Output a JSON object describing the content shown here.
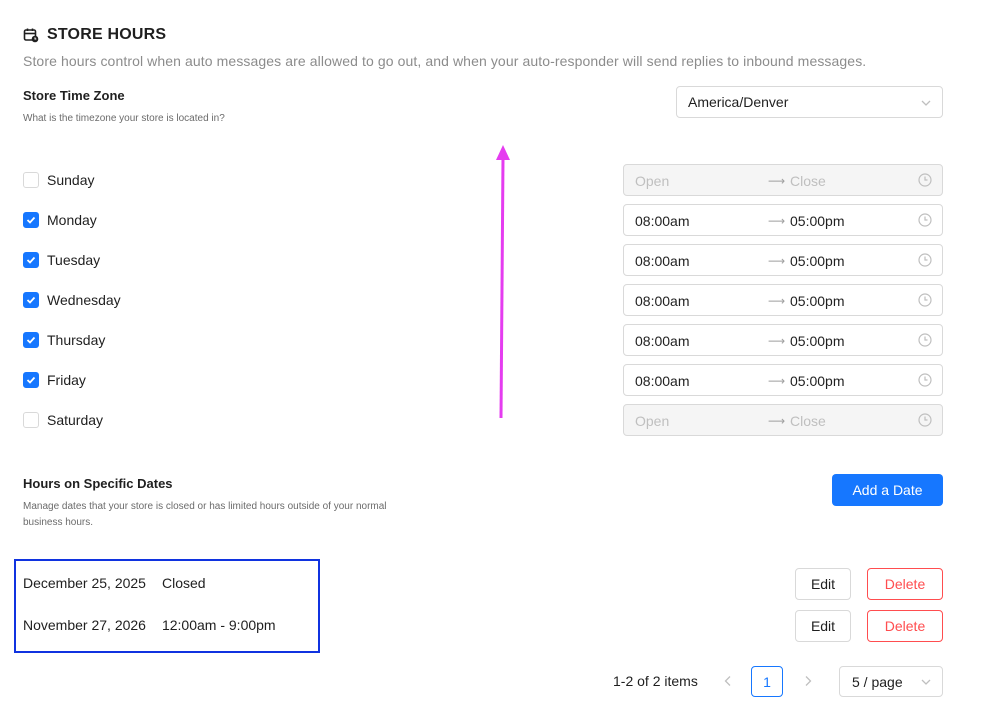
{
  "header": {
    "title": "STORE HOURS",
    "subtitle": "Store hours control when auto messages are allowed to go out, and when your auto-responder will send replies to inbound messages."
  },
  "timezone": {
    "label": "Store Time Zone",
    "help": "What is the timezone your store is located in?",
    "value": "America/Denver"
  },
  "days": [
    {
      "name": "Sunday",
      "checked": false,
      "open": "Open",
      "close": "Close"
    },
    {
      "name": "Monday",
      "checked": true,
      "open": "08:00am",
      "close": "05:00pm"
    },
    {
      "name": "Tuesday",
      "checked": true,
      "open": "08:00am",
      "close": "05:00pm"
    },
    {
      "name": "Wednesday",
      "checked": true,
      "open": "08:00am",
      "close": "05:00pm"
    },
    {
      "name": "Thursday",
      "checked": true,
      "open": "08:00am",
      "close": "05:00pm"
    },
    {
      "name": "Friday",
      "checked": true,
      "open": "08:00am",
      "close": "05:00pm"
    },
    {
      "name": "Saturday",
      "checked": false,
      "open": "Open",
      "close": "Close"
    }
  ],
  "specific_dates": {
    "label": "Hours on Specific Dates",
    "help": "Manage dates that your store is closed or has limited hours outside of your normal business hours.",
    "add_label": "Add a Date",
    "edit_label": "Edit",
    "delete_label": "Delete",
    "items": [
      {
        "date": "December 25, 2025",
        "hours": "Closed"
      },
      {
        "date": "November 27, 2026",
        "hours": "12:00am - 9:00pm"
      }
    ]
  },
  "pagination": {
    "total": "1-2 of 2 items",
    "current_page": "1",
    "page_size": "5 / page"
  },
  "colors": {
    "primary": "#1677ff",
    "danger": "#ff4d4f",
    "annotation_arrow": "#e53cf0",
    "annotation_box": "#1033e0"
  },
  "icons": {
    "header": "calendar-clock-icon",
    "checkbox": "checkmark-icon",
    "time": "clock-icon",
    "select": "chevron-down-icon"
  }
}
